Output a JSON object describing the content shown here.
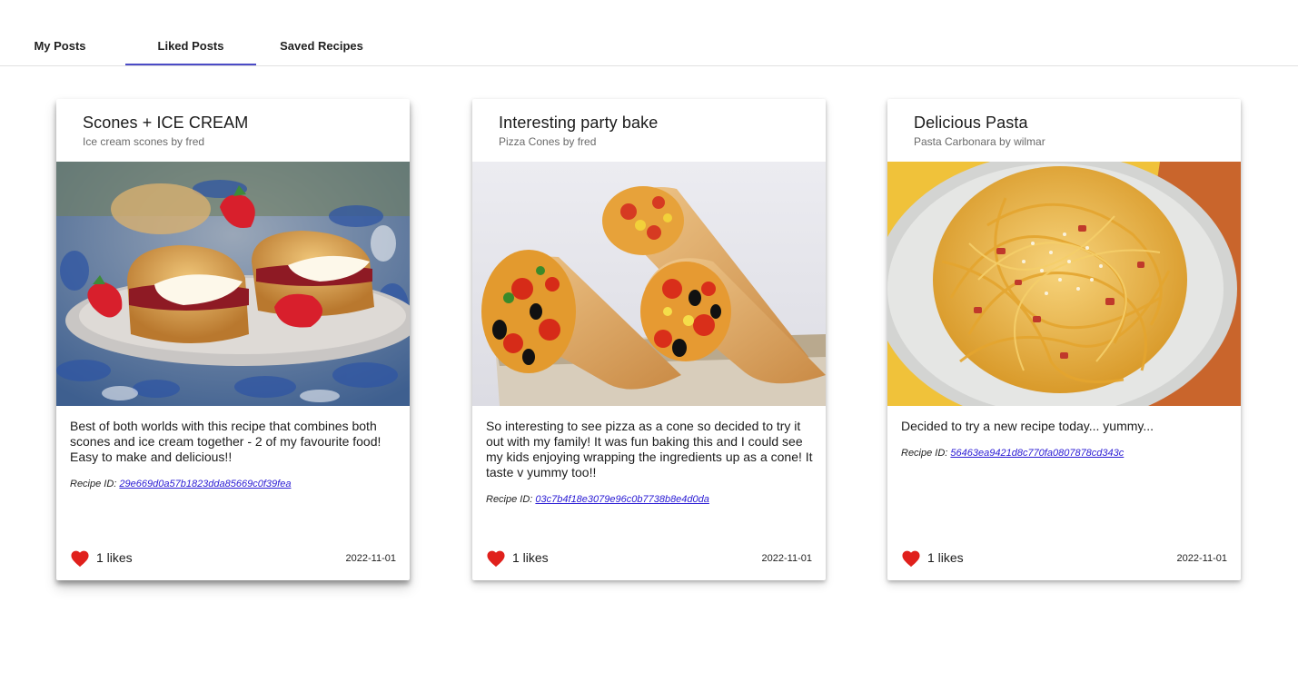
{
  "tabs": [
    {
      "label": "My Posts",
      "active": false
    },
    {
      "label": "Liked Posts",
      "active": true
    },
    {
      "label": "Saved Recipes",
      "active": false
    }
  ],
  "accent_color": "#4b4bc6",
  "heart_color": "#e0201c",
  "link_color": "#2a1bd4",
  "cards": [
    {
      "title": "Scones + ICE CREAM",
      "subtitle": "Ice cream scones by fred",
      "image": "scones-with-cream-and-strawberries",
      "text": "Best of both worlds with this recipe that combines both scones and ice cream together - 2 of my favourite food! Easy to make and delicious!!",
      "recipe_label": "Recipe ID:",
      "recipe_id": "29e669d0a57b1823dda85669c0f39fea",
      "heart_icon": "heart-icon",
      "likes": "1 likes",
      "date": "2022-11-01"
    },
    {
      "title": "Interesting party bake",
      "subtitle": "Pizza Cones by fred",
      "image": "pizza-cones",
      "text": "So interesting to see pizza as a cone so decided to try it out with my family! It was fun baking this and I could see my kids enjoying wrapping the ingredients up as a cone! It taste v yummy too!!",
      "recipe_label": "Recipe ID:",
      "recipe_id": "03c7b4f18e3079e96c0b7738b8e4d0da",
      "heart_icon": "heart-icon",
      "likes": "1 likes",
      "date": "2022-11-01"
    },
    {
      "title": "Delicious Pasta",
      "subtitle": "Pasta Carbonara by wilmar",
      "image": "pasta-carbonara",
      "text": "Decided to try a new recipe today... yummy...",
      "recipe_label": "Recipe ID:",
      "recipe_id": "56463ea9421d8c770fa0807878cd343c",
      "heart_icon": "heart-icon",
      "likes": "1 likes",
      "date": "2022-11-01"
    }
  ]
}
